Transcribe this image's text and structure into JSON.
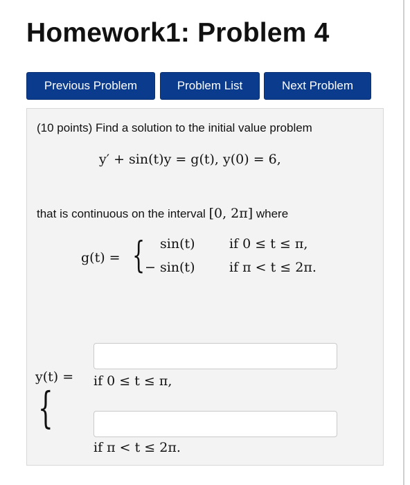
{
  "header": {
    "title": "Homework1: Problem 4"
  },
  "nav": {
    "previous_label": "Previous Problem",
    "list_label": "Problem List",
    "next_label": "Next Problem"
  },
  "problem": {
    "intro": "(10 points) Find a solution to the initial value problem",
    "ode": "y′ + sin(t)y = g(t),   y(0) = 6,",
    "interval_text": "that is continuous on the interval",
    "interval_math": "[0, 2π]",
    "interval_suffix": "where",
    "g_lhs": "g(t) =",
    "g_case1_expr": "sin(t)",
    "g_case1_cond": "if 0 ≤ t ≤ π,",
    "g_case2_expr": "− sin(t)",
    "g_case2_cond": "if π < t ≤ 2π.",
    "y_lhs": "y(t) =",
    "y_case1_cond": "if 0 ≤ t ≤ π,",
    "y_case2_cond": "if π < t ≤ 2π.",
    "answer1_value": "",
    "answer2_value": ""
  },
  "colors": {
    "button_bg": "#0b3b8c",
    "panel_bg": "#f3f3f3"
  }
}
